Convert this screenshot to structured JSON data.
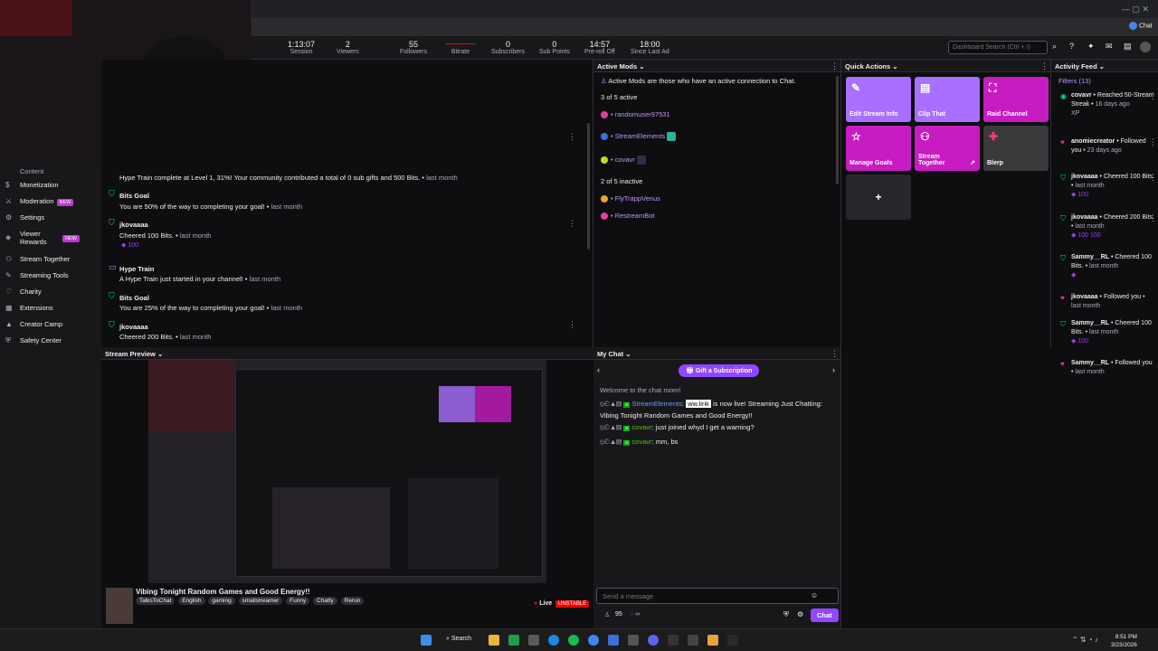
{
  "browser": {
    "profile": "Chat"
  },
  "stats": [
    {
      "value": "1:13:07",
      "label": "Session"
    },
    {
      "value": "2",
      "label": "Viewers"
    },
    {
      "value": "55",
      "label": "Followers"
    },
    {
      "value": "",
      "label": "Bitrate"
    },
    {
      "value": "0",
      "label": "Subscribers"
    },
    {
      "value": "0",
      "label": "Sub Points"
    },
    {
      "value": "14:57",
      "label": "Pre-roll Off"
    },
    {
      "value": "18:00",
      "label": "Since Last Ad"
    }
  ],
  "search": {
    "placeholder": "Dashboard Search (Ctrl + /)"
  },
  "sidebar": {
    "items": [
      {
        "label": "Content"
      },
      {
        "label": "Monetization"
      },
      {
        "label": "Moderation",
        "badge": "NEW"
      },
      {
        "label": "Settings"
      },
      {
        "label": "Viewer Rewards",
        "badge": "NEW"
      },
      {
        "label": "Stream Together"
      },
      {
        "label": "Streaming Tools"
      },
      {
        "label": "Charity"
      },
      {
        "label": "Extensions"
      },
      {
        "label": "Creator Camp"
      },
      {
        "label": "Safety Center"
      }
    ]
  },
  "feed": {
    "items": [
      {
        "text": "Hype Train complete at Level 1, 31%! Your community contributed a total of 0 sub gifts and 500 Bits.",
        "time": "last month"
      },
      {
        "title": "Bits Goal",
        "text": "You are 50% of the way to completing your goal!",
        "time": "last month"
      },
      {
        "title": "jkovaaaa",
        "text": "Cheered 100 Bits.",
        "time": "last month",
        "bits": "100"
      },
      {
        "title": "Hype Train",
        "text": "A Hype Train just started in your channel!",
        "time": "last month"
      },
      {
        "title": "Bits Goal",
        "text": "You are 25% of the way to completing your goal!",
        "time": "last month"
      },
      {
        "title": "jkovaaaa",
        "text": "Cheered 200 Bits.",
        "time": "last month"
      }
    ]
  },
  "preview": {
    "header": "Stream Preview",
    "title": "Vibing Tonight Random Games and Good Energy!!",
    "tags": [
      "TalksToChat",
      "English",
      "gaming",
      "smallstreamer",
      "Funny",
      "Chatty",
      "Rerun"
    ],
    "live": "Live",
    "unstable": "UNSTABLE"
  },
  "mods": {
    "header": "Active Mods",
    "info": "Active Mods are those who have an active connection to Chat.",
    "active_count": "3 of 5 active",
    "active": [
      {
        "name": "randomuser97531",
        "color": "#e040a0"
      },
      {
        "name": "StreamElements",
        "color": "#3b6fd8"
      },
      {
        "name": "covavr",
        "color": "#c5d82a"
      }
    ],
    "inactive_count": "2 of 5 inactive",
    "inactive": [
      {
        "name": "FlyTrappVenus",
        "color": "#f0a030"
      },
      {
        "name": "RestreamBot",
        "color": "#e040a0"
      }
    ]
  },
  "quick": {
    "header": "Quick Actions",
    "actions": [
      {
        "label": "Edit Stream Info",
        "icon": "pencil-icon",
        "color": "#a970ff"
      },
      {
        "label": "Clip That",
        "icon": "clapper-icon",
        "color": "#a970ff"
      },
      {
        "label": "Raid Channel",
        "icon": "raid-icon",
        "color": "#c71cc2"
      },
      {
        "label": "Manage Goals",
        "icon": "star-icon",
        "color": "#c71cc2"
      },
      {
        "label": "Stream Together",
        "icon": "add-user-icon",
        "color": "#c71cc2"
      },
      {
        "label": "Blerp",
        "icon": "blerp-icon",
        "color": "#3a3a3d"
      }
    ],
    "add": "+"
  },
  "chat": {
    "header": "My Chat",
    "gift": "Gift a Subscription",
    "welcome": "Welcome to the chat room!",
    "messages": [
      {
        "user": "StreamElements",
        "color": "#5ea0ff",
        "link": "ww.link",
        "text": "is now live! Streaming Just Chatting: Vibing Tonight Random Games and Good Energy!!"
      },
      {
        "user": "covavr",
        "color": "#52c11a",
        "text": "just joined whyd I get a warning?"
      },
      {
        "user": "covavr",
        "color": "#52c11a",
        "text": "mm, bs"
      }
    ],
    "input_placeholder": "Send a message",
    "points": "95",
    "chat_button": "Chat"
  },
  "activity": {
    "header": "Activity Feed",
    "filters": "Filters (13)",
    "items": [
      {
        "name": "covavr",
        "text": "Reached 50-Stream Streak",
        "time": "16 days ago",
        "extra": "XP",
        "icon": "streak-icon"
      },
      {
        "name": "anomiecreator",
        "text": "Followed you",
        "time": "23 days ago",
        "icon": "heart-icon"
      },
      {
        "name": "jkovaaaa",
        "text": "Cheered 100 Bits.",
        "time": "last month",
        "bits": "100",
        "icon": "bits-icon"
      },
      {
        "name": "jkovaaaa",
        "text": "Cheered 200 Bits.",
        "time": "last month",
        "bits": "100  100",
        "icon": "bits-icon"
      },
      {
        "name": "Sammy__RL",
        "text": "Cheered 100 Bits.",
        "time": "last month",
        "icon": "bits-icon"
      },
      {
        "name": "jkovaaaa",
        "text": "Followed you",
        "time": "last month",
        "icon": "heart-icon"
      },
      {
        "name": "Sammy__RL",
        "text": "Cheered 100 Bits.",
        "time": "last month",
        "bits": "100",
        "icon": "bits-icon"
      },
      {
        "name": "Sammy__RL",
        "text": "Followed you",
        "time": "last month",
        "icon": "heart-icon"
      }
    ]
  },
  "taskbar": {
    "search": "Search",
    "time": "8:51 PM",
    "date": "3/23/2026"
  }
}
